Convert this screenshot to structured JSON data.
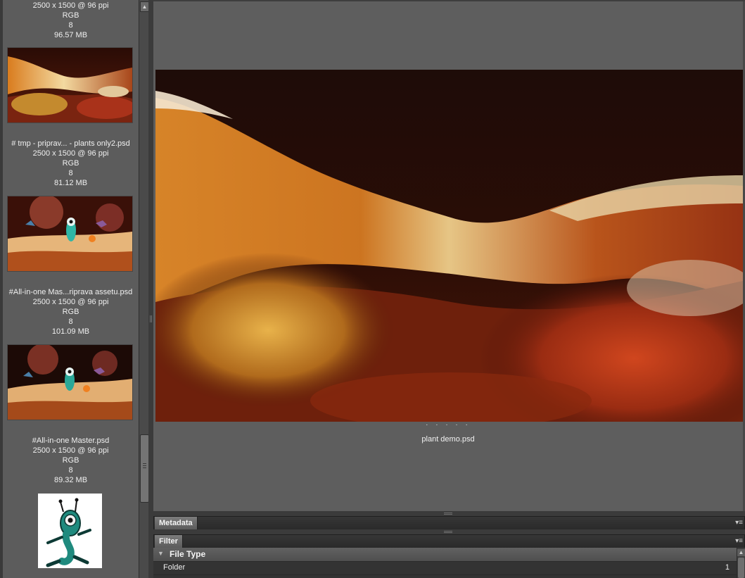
{
  "content_panel": {
    "items": [
      {
        "name": "",
        "dimensions": "2500 x 1500 @ 96 ppi",
        "color_mode": "RGB",
        "bit_depth": "8",
        "file_size": "96.57 MB"
      },
      {
        "name": "# tmp - priprav... - plants only2.psd",
        "dimensions": "2500 x 1500 @ 96 ppi",
        "color_mode": "RGB",
        "bit_depth": "8",
        "file_size": "81.12 MB"
      },
      {
        "name": "#All-in-one Mas...riprava assetu.psd",
        "dimensions": "2500 x 1500 @ 96 ppi",
        "color_mode": "RGB",
        "bit_depth": "8",
        "file_size": "101.09 MB"
      },
      {
        "name": "#All-in-one Master.psd",
        "dimensions": "2500 x 1500 @ 96 ppi",
        "color_mode": "RGB",
        "bit_depth": "8",
        "file_size": "89.32 MB"
      }
    ],
    "scroll_up_glyph": "▲"
  },
  "preview": {
    "rating_dots": "· · · · ·",
    "filename": "plant demo.psd"
  },
  "panels": {
    "metadata": {
      "tab_label": "Metadata",
      "menu_glyph": "▾≡"
    },
    "filter": {
      "tab_label": "Filter",
      "menu_glyph": "▾≡",
      "section_toggle_glyph": "▼",
      "section_title": "File Type",
      "rows": [
        {
          "label": "Folder",
          "count": "1"
        }
      ]
    }
  },
  "colors": {
    "panel_background": "#5c5c5c",
    "preview_background": "#5e5e5e",
    "chrome_dark": "#3a3a3a",
    "text": "#f0f0f0"
  }
}
